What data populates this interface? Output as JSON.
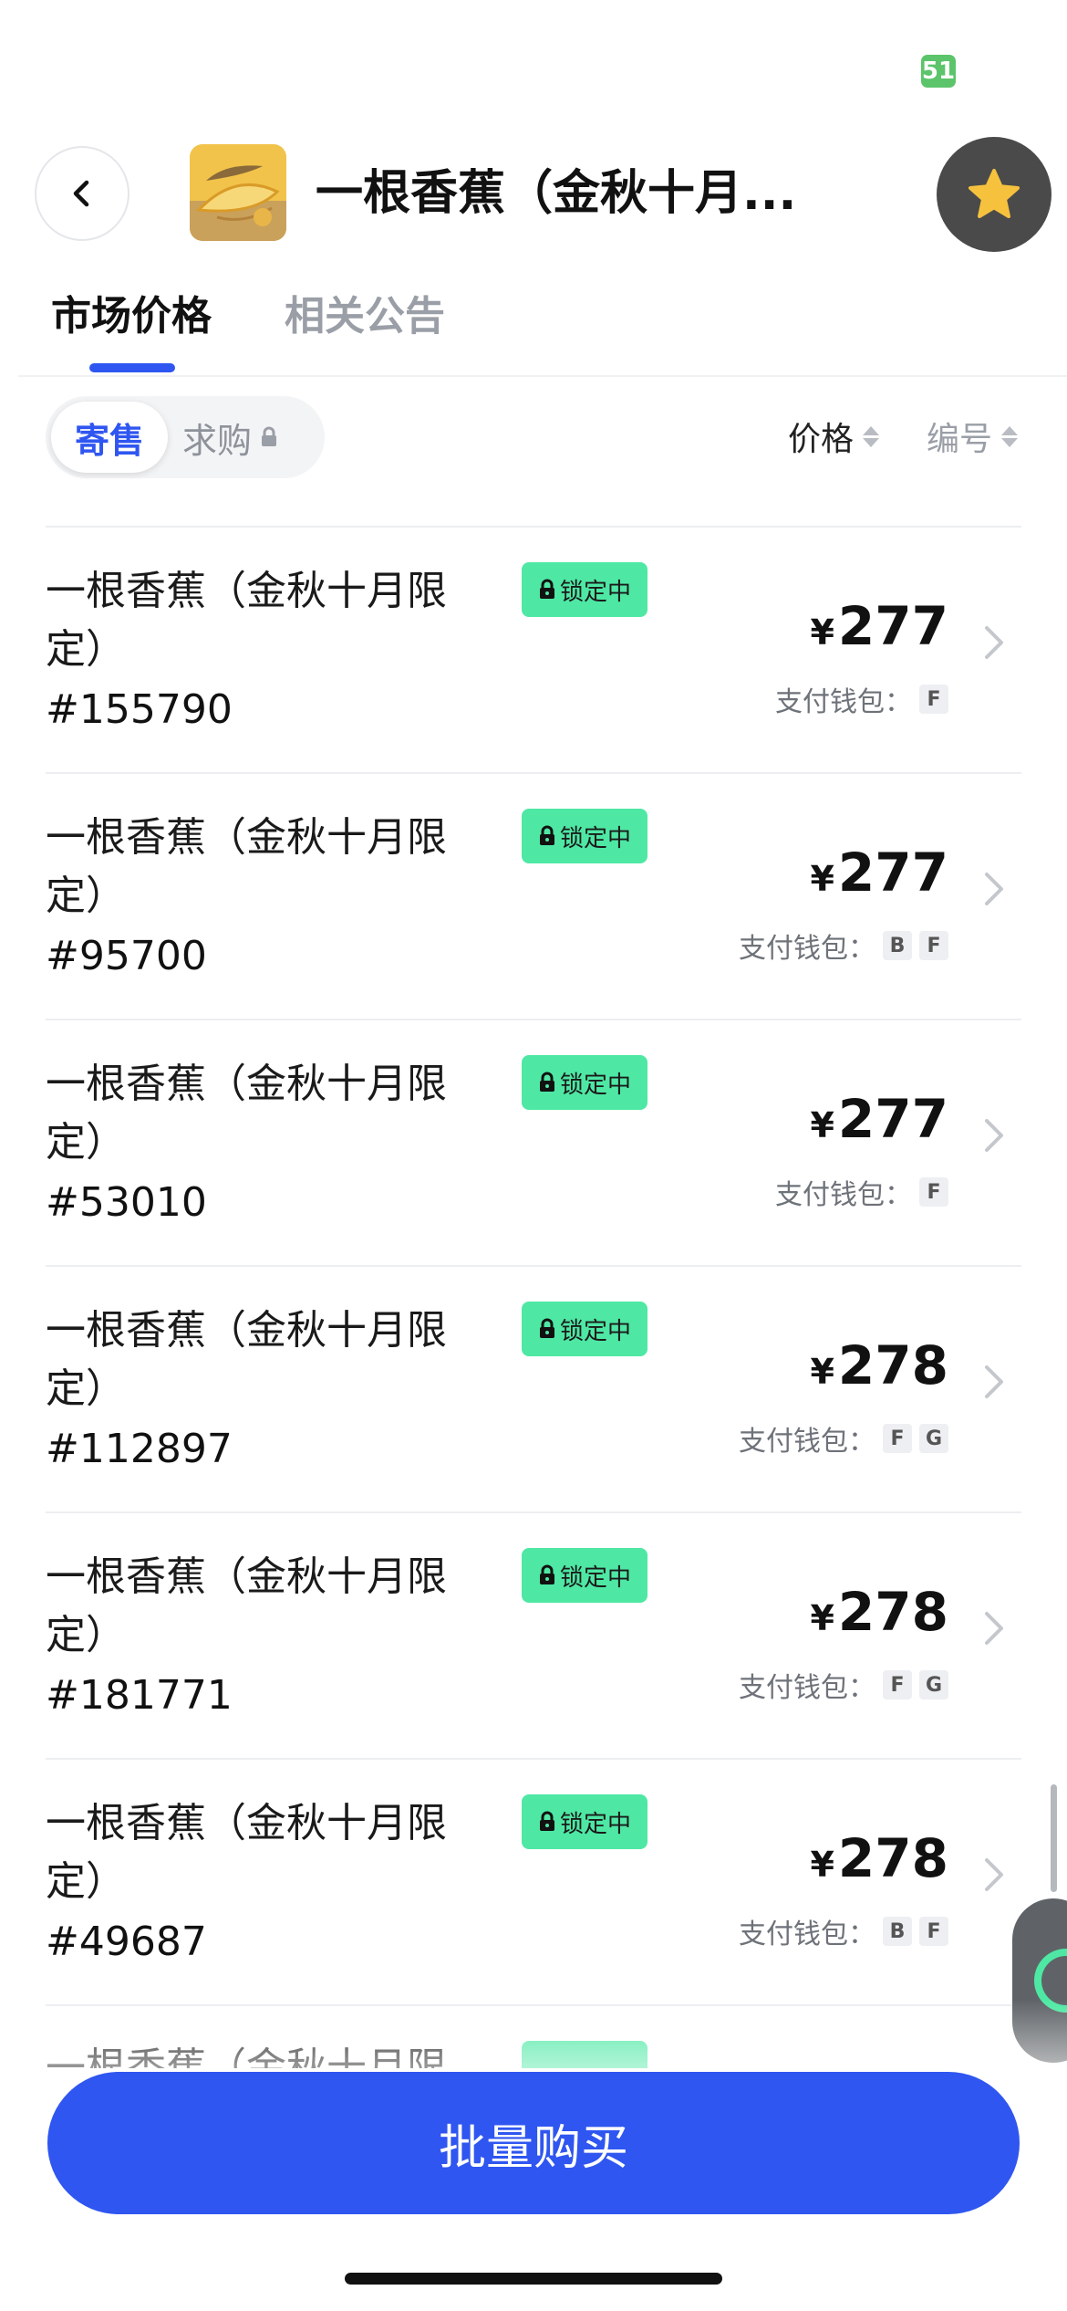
{
  "status": {
    "badge": "51"
  },
  "header": {
    "title": "一根香蕉（金秋十月...",
    "back_icon": "chevron-left-icon",
    "fav_icon": "star-icon",
    "colors": {
      "star": "#f6c23e",
      "fav_bg": "#4a4a4a"
    }
  },
  "tabs": [
    {
      "label": "市场价格",
      "active": true
    },
    {
      "label": "相关公告",
      "active": false
    }
  ],
  "filter": {
    "segments": [
      {
        "label": "寄售",
        "active": true
      },
      {
        "label": "求购",
        "active": false,
        "icon": "lock-icon"
      }
    ],
    "sort": [
      {
        "label": "价格"
      },
      {
        "label": "编号"
      }
    ]
  },
  "listings": [
    {
      "name": "一根香蕉（金秋十月限定）",
      "serial": "#155790",
      "status": "锁定中",
      "currency": "¥",
      "price": "277",
      "wallet_label": "支付钱包：",
      "wallets": [
        "F"
      ]
    },
    {
      "name": "一根香蕉（金秋十月限定）",
      "serial": "#95700",
      "status": "锁定中",
      "currency": "¥",
      "price": "277",
      "wallet_label": "支付钱包：",
      "wallets": [
        "B",
        "F"
      ]
    },
    {
      "name": "一根香蕉（金秋十月限定）",
      "serial": "#53010",
      "status": "锁定中",
      "currency": "¥",
      "price": "277",
      "wallet_label": "支付钱包：",
      "wallets": [
        "F"
      ]
    },
    {
      "name": "一根香蕉（金秋十月限定）",
      "serial": "#112897",
      "status": "锁定中",
      "currency": "¥",
      "price": "278",
      "wallet_label": "支付钱包：",
      "wallets": [
        "F",
        "G"
      ]
    },
    {
      "name": "一根香蕉（金秋十月限定）",
      "serial": "#181771",
      "status": "锁定中",
      "currency": "¥",
      "price": "278",
      "wallet_label": "支付钱包：",
      "wallets": [
        "F",
        "G"
      ]
    },
    {
      "name": "一根香蕉（金秋十月限定）",
      "serial": "#49687",
      "status": "锁定中",
      "currency": "¥",
      "price": "278",
      "wallet_label": "支付钱包：",
      "wallets": [
        "B",
        "F"
      ]
    }
  ],
  "partial_row": {
    "text": "一根香蕉（金秋十月限"
  },
  "footer": {
    "button_label": "批量购买",
    "colors": {
      "primary": "#2f56f0",
      "lock_badge": "#4ee8a4"
    }
  }
}
